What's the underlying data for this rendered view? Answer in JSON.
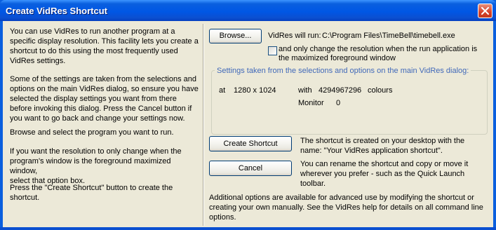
{
  "window": {
    "title": "Create VidRes Shortcut"
  },
  "instructions": [
    [
      "You can use VidRes to run another program at a",
      "specific display resolution. This facility lets you create a",
      "shortcut to do this using the most frequently used",
      "VidRes settings."
    ],
    [
      "Some of the settings are taken from the selections and",
      "options on the main VidRes dialog, so ensure you have",
      "selected the display settings you want from there",
      "before invoking this dialog. Press the Cancel button if",
      "you want to go back and change your settings now."
    ],
    [
      "Browse and select the program you want to run."
    ],
    [
      "If you want the resolution to only change when the",
      "program's window is the foreground maximized window,",
      "select that option box."
    ],
    [
      "Press the \"Create Shortcut\" button to create the",
      "shortcut."
    ]
  ],
  "browse": {
    "button_label": "Browse...",
    "run_label": "VidRes will run:",
    "run_path": "C:\\Program Files\\TimeBell\\timebell.exe",
    "option_line1": "and only change the resolution when the run application is",
    "option_line2": "the maximized foreground window",
    "option_checked": false
  },
  "settings": {
    "group_title": "Settings taken from the selections and options on the main VidRes dialog:",
    "at_label": "at",
    "resolution": "1280 x 1024",
    "with_label": "with",
    "colours_value": "4294967296",
    "colours_label": "colours",
    "monitor_label": "Monitor",
    "monitor_value": "0"
  },
  "actions": {
    "create_label": "Create Shortcut",
    "cancel_label": "Cancel",
    "create_desc": [
      "The shortcut is created on your desktop with the",
      "name: \"Your VidRes application shortcut\"."
    ],
    "cancel_desc": [
      "You can rename the shortcut and copy or move it",
      "wherever you prefer - such as the Quick Launch",
      "toolbar."
    ]
  },
  "footer_note": [
    "Additional options are available for advanced use by modifying the shortcut or",
    "creating your own manually. See the VidRes help for details on all command line",
    "options."
  ]
}
